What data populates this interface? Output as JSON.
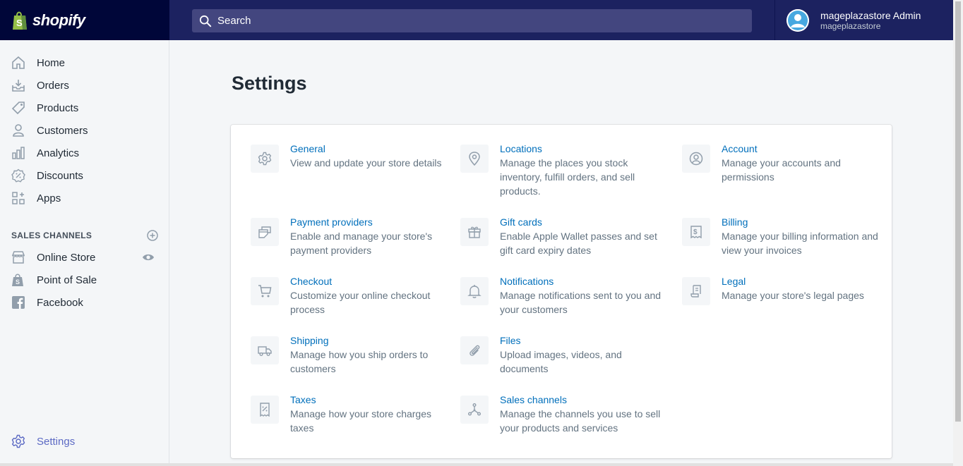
{
  "brand": {
    "name": "shopify"
  },
  "search": {
    "placeholder": "Search"
  },
  "user": {
    "name": "mageplazastore Admin",
    "store": "mageplazastore"
  },
  "sidebar": {
    "items": [
      {
        "label": "Home",
        "icon": "home-icon"
      },
      {
        "label": "Orders",
        "icon": "orders-icon"
      },
      {
        "label": "Products",
        "icon": "tag-icon"
      },
      {
        "label": "Customers",
        "icon": "person-icon"
      },
      {
        "label": "Analytics",
        "icon": "bar-chart-icon"
      },
      {
        "label": "Discounts",
        "icon": "discount-icon"
      },
      {
        "label": "Apps",
        "icon": "apps-icon"
      }
    ],
    "sales_channels_heading": "SALES CHANNELS",
    "channels": [
      {
        "label": "Online Store",
        "icon": "store-icon"
      },
      {
        "label": "Point of Sale",
        "icon": "pos-icon"
      },
      {
        "label": "Facebook",
        "icon": "facebook-icon"
      }
    ],
    "settings_label": "Settings"
  },
  "main": {
    "title": "Settings",
    "settings": [
      {
        "title": "General",
        "desc": "View and update your store details",
        "icon": "gear-icon"
      },
      {
        "title": "Locations",
        "desc": "Manage the places you stock inventory, fulfill orders, and sell products.",
        "icon": "location-pin-icon"
      },
      {
        "title": "Account",
        "desc": "Manage your accounts and permissions",
        "icon": "account-icon"
      },
      {
        "title": "Payment providers",
        "desc": "Enable and manage your store's payment providers",
        "icon": "payment-icon"
      },
      {
        "title": "Gift cards",
        "desc": "Enable Apple Wallet passes and set gift card expiry dates",
        "icon": "gift-icon"
      },
      {
        "title": "Billing",
        "desc": "Manage your billing information and view your invoices",
        "icon": "billing-icon"
      },
      {
        "title": "Checkout",
        "desc": "Customize your online checkout process",
        "icon": "cart-icon"
      },
      {
        "title": "Notifications",
        "desc": "Manage notifications sent to you and your customers",
        "icon": "bell-icon"
      },
      {
        "title": "Legal",
        "desc": "Manage your store's legal pages",
        "icon": "legal-icon"
      },
      {
        "title": "Shipping",
        "desc": "Manage how you ship orders to customers",
        "icon": "truck-icon"
      },
      {
        "title": "Files",
        "desc": "Upload images, videos, and documents",
        "icon": "paperclip-icon"
      },
      {
        "title": "Taxes",
        "desc": "Manage how your store charges taxes",
        "icon": "tax-icon"
      },
      {
        "title": "Sales channels",
        "desc": "Manage the channels you use to sell your products and services",
        "icon": "sales-channels-icon"
      }
    ]
  },
  "colors": {
    "topbar": "#1c2260",
    "logo_bg": "#000639",
    "link": "#006fbb",
    "active": "#5c6ac4"
  }
}
